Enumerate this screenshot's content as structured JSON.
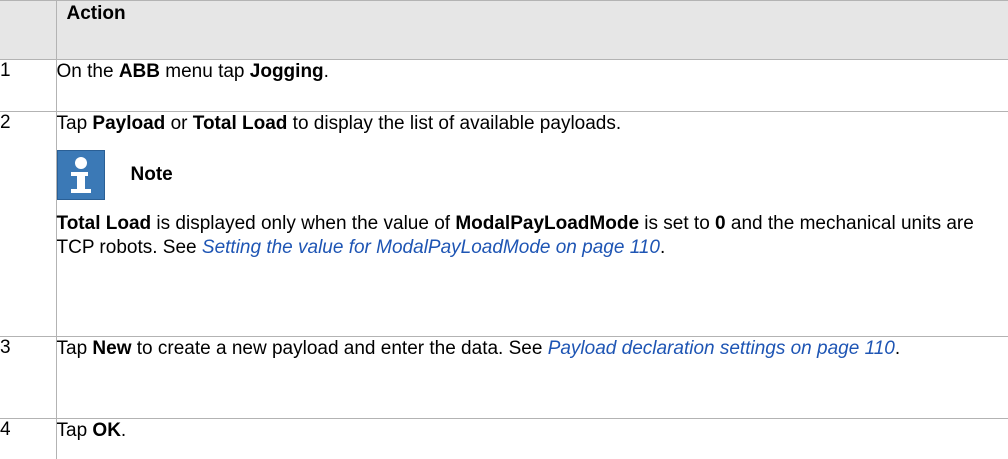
{
  "table": {
    "header": {
      "number": "",
      "action": "Action"
    },
    "rows": [
      {
        "number": "1",
        "parts": [
          "On the ",
          "ABB",
          " menu tap ",
          "Jogging",
          "."
        ]
      },
      {
        "number": "2",
        "parts": [
          "Tap ",
          "Payload",
          " or ",
          "Total Load",
          " to display the list of available payloads."
        ],
        "note": {
          "icon": "info-icon",
          "label": "Note",
          "parts": [
            "Total Load",
            " is displayed only when the value of ",
            "ModalPayLoadMode",
            " is set to ",
            "0",
            " and the mechanical units are TCP robots. See ",
            "Setting the value for ModalPayLoadMode on page 110",
            "."
          ]
        }
      },
      {
        "number": "3",
        "parts": [
          "Tap ",
          "New",
          " to create a new payload and enter the data. See ",
          "Payload declaration settings on page 110",
          "."
        ]
      },
      {
        "number": "4",
        "parts": [
          "Tap ",
          "OK",
          "."
        ]
      }
    ]
  },
  "colors": {
    "header_bg": "#e6e6e6",
    "border": "#b3b3b3",
    "link": "#1e55b4",
    "note_icon_bg": "#3b79b6"
  }
}
